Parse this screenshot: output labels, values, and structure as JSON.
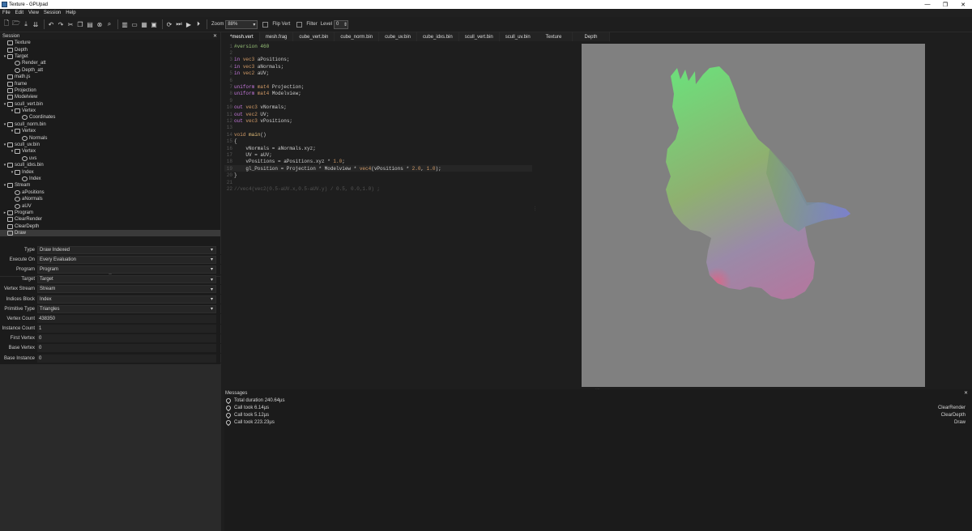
{
  "window": {
    "title": "Texture - GPUpad",
    "min": "—",
    "max": "❐",
    "close": "✕"
  },
  "menu": [
    "File",
    "Edit",
    "View",
    "Session",
    "Help"
  ],
  "toolbar": {
    "zoom_label": "Zoom",
    "zoom_value": "88%",
    "flip_label": "Flip Vert",
    "filter_label": "Filter",
    "level_label": "Level",
    "level_value": "0"
  },
  "session": {
    "title": "Session",
    "tree": [
      {
        "label": "Texture",
        "depth": 0,
        "arrow": "",
        "icon": "texture-icon"
      },
      {
        "label": "Depth",
        "depth": 0,
        "arrow": "",
        "icon": "texture-icon"
      },
      {
        "label": "Target",
        "depth": 0,
        "arrow": "▾",
        "icon": "target-icon"
      },
      {
        "label": "Render_att",
        "depth": 1,
        "arrow": "",
        "icon": "attachment-icon"
      },
      {
        "label": "Depth_att",
        "depth": 1,
        "arrow": "",
        "icon": "attachment-icon"
      },
      {
        "label": "math.js",
        "depth": 0,
        "arrow": "",
        "icon": "script-icon"
      },
      {
        "label": "frame",
        "depth": 0,
        "arrow": "",
        "icon": "binding-icon"
      },
      {
        "label": "Projection",
        "depth": 0,
        "arrow": "",
        "icon": "binding-icon"
      },
      {
        "label": "Modelview",
        "depth": 0,
        "arrow": "",
        "icon": "binding-icon"
      },
      {
        "label": "scull_vert.bin",
        "depth": 0,
        "arrow": "▾",
        "icon": "buffer-icon"
      },
      {
        "label": "Vertex",
        "depth": 1,
        "arrow": "▾",
        "icon": "block-icon"
      },
      {
        "label": "Coordinates",
        "depth": 2,
        "arrow": "",
        "icon": "field-icon"
      },
      {
        "label": "scull_norm.bin",
        "depth": 0,
        "arrow": "▾",
        "icon": "buffer-icon"
      },
      {
        "label": "Vertex",
        "depth": 1,
        "arrow": "▾",
        "icon": "block-icon"
      },
      {
        "label": "Normals",
        "depth": 2,
        "arrow": "",
        "icon": "field-icon"
      },
      {
        "label": "scull_uv.bin",
        "depth": 0,
        "arrow": "▾",
        "icon": "buffer-icon"
      },
      {
        "label": "Vertex",
        "depth": 1,
        "arrow": "▾",
        "icon": "block-icon"
      },
      {
        "label": "uvs",
        "depth": 2,
        "arrow": "",
        "icon": "field-icon"
      },
      {
        "label": "scull_idxs.bin",
        "depth": 0,
        "arrow": "▾",
        "icon": "buffer-icon"
      },
      {
        "label": "Index",
        "depth": 1,
        "arrow": "▾",
        "icon": "block-icon"
      },
      {
        "label": "Index",
        "depth": 2,
        "arrow": "",
        "icon": "field-icon"
      },
      {
        "label": "Stream",
        "depth": 0,
        "arrow": "▾",
        "icon": "stream-icon"
      },
      {
        "label": "aPositions",
        "depth": 1,
        "arrow": "",
        "icon": "attribute-icon"
      },
      {
        "label": "aNormals",
        "depth": 1,
        "arrow": "",
        "icon": "attribute-icon"
      },
      {
        "label": "aUV",
        "depth": 1,
        "arrow": "",
        "icon": "attribute-icon"
      },
      {
        "label": "Program",
        "depth": 0,
        "arrow": "▸",
        "icon": "program-icon"
      },
      {
        "label": "ClearRender",
        "depth": 0,
        "arrow": "",
        "icon": "call-icon"
      },
      {
        "label": "ClearDepth",
        "depth": 0,
        "arrow": "",
        "icon": "call-icon"
      },
      {
        "label": "Draw",
        "depth": 0,
        "arrow": "",
        "icon": "call-icon",
        "selected": true
      }
    ]
  },
  "properties": [
    {
      "label": "Type",
      "value": "Draw Indexed",
      "combo": true
    },
    {
      "label": "Execute On",
      "value": "Every Evaluation",
      "combo": true
    },
    {
      "label": "Program",
      "value": "Program",
      "combo": true
    },
    {
      "label": "Target",
      "value": "Target",
      "combo": true
    },
    {
      "label": "Vertex Stream",
      "value": "Stream",
      "combo": true
    },
    {
      "label": "Indices Block",
      "value": "Index",
      "combo": true
    },
    {
      "label": "Primitive Type",
      "value": "Triangles",
      "combo": true
    },
    {
      "label": "Vertex Count",
      "value": "438350",
      "combo": false
    },
    {
      "label": "Instance Count",
      "value": "1",
      "combo": false
    },
    {
      "label": "First Vertex",
      "value": "0",
      "combo": false
    },
    {
      "label": "Base Vertex",
      "value": "0",
      "combo": false
    },
    {
      "label": "Base Instance",
      "value": "0",
      "combo": false
    }
  ],
  "editor_tabs": [
    "*mesh.vert",
    "mesh.frag",
    "cube_vert.bin",
    "cube_norm.bin",
    "cube_uv.bin",
    "cube_idxs.bin",
    "scull_vert.bin",
    "scull_uv.bin"
  ],
  "code_lines": [
    [
      [
        "pp",
        "#version 460"
      ]
    ],
    [],
    [
      [
        "kw",
        "in "
      ],
      [
        "ty",
        "vec3 "
      ],
      [
        "pl",
        "aPositions;"
      ]
    ],
    [
      [
        "kw",
        "in "
      ],
      [
        "ty",
        "vec3 "
      ],
      [
        "pl",
        "aNormals;"
      ]
    ],
    [
      [
        "kw",
        "in "
      ],
      [
        "ty",
        "vec2 "
      ],
      [
        "pl",
        "aUV;"
      ]
    ],
    [],
    [
      [
        "kw",
        "uniform "
      ],
      [
        "ty",
        "mat4 "
      ],
      [
        "pl",
        "Projection;"
      ]
    ],
    [
      [
        "kw",
        "uniform "
      ],
      [
        "ty",
        "mat4 "
      ],
      [
        "pl",
        "Modelview;"
      ]
    ],
    [],
    [
      [
        "kw",
        "out "
      ],
      [
        "ty",
        "vec3 "
      ],
      [
        "pl",
        "vNormals;"
      ]
    ],
    [
      [
        "kw",
        "out "
      ],
      [
        "ty",
        "vec2 "
      ],
      [
        "pl",
        "UV;"
      ]
    ],
    [
      [
        "kw",
        "out "
      ],
      [
        "ty",
        "vec3 "
      ],
      [
        "pl",
        "vPositions;"
      ]
    ],
    [],
    [
      [
        "ty",
        "void "
      ],
      [
        "vr",
        "main"
      ],
      [
        "pl",
        "()"
      ]
    ],
    [
      [
        "pl",
        "{"
      ]
    ],
    [
      [
        "pl",
        "    vNormals = aNormals.xyz;"
      ]
    ],
    [
      [
        "pl",
        "    UV = aUV;"
      ]
    ],
    [
      [
        "pl",
        "    vPositions = aPositions.xyz * "
      ],
      [
        "nm",
        "1.0"
      ],
      [
        "pl",
        ";"
      ]
    ],
    [
      [
        "pl",
        "    gl_Position = Projection * Modelview * "
      ],
      [
        "ty",
        "vec4"
      ],
      [
        "pl",
        "(vPositions * "
      ],
      [
        "nm",
        "2.0"
      ],
      [
        "pl",
        ", "
      ],
      [
        "nm",
        "1.0"
      ],
      [
        "pl",
        ");"
      ]
    ],
    [
      [
        "pl",
        "}"
      ]
    ],
    [],
    [
      [
        "cm",
        "//vec4(vec2(0.5-aUV.x,0.5-aUV.y) / 0.5, 0.0,1.0) ;"
      ]
    ]
  ],
  "highlight_line": 19,
  "preview_tabs": [
    "Texture",
    "Depth"
  ],
  "messages": {
    "title": "Messages",
    "items": [
      {
        "text": "Total duration 240.64µs",
        "source": ""
      },
      {
        "text": "Call took 6.14µs",
        "source": "ClearRender"
      },
      {
        "text": "Call took 5.12µs",
        "source": "ClearDepth"
      },
      {
        "text": "Call took 223.23µs",
        "source": "Draw"
      }
    ]
  },
  "colors": {
    "background": "#1e1e1e",
    "canvas": "#808080",
    "selection": "#3a3a3a"
  }
}
